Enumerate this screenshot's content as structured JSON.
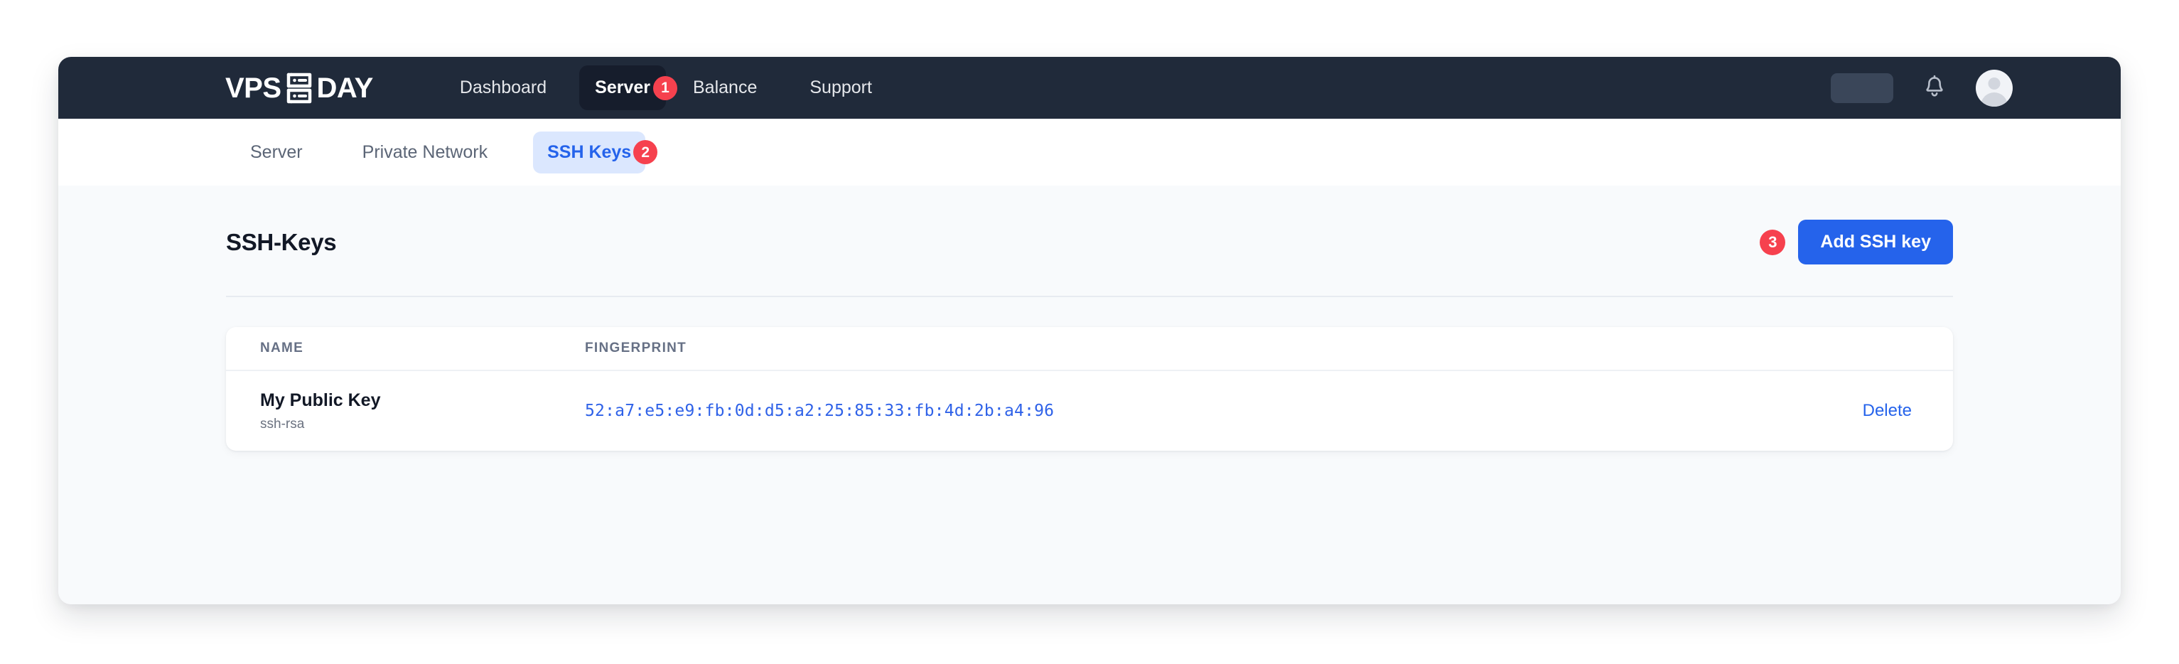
{
  "brand": {
    "text_left": "VPS",
    "text_right": "DAY",
    "icon": "server-rack-icon"
  },
  "navbar": {
    "links": [
      {
        "label": "Dashboard",
        "active": false,
        "badge": null
      },
      {
        "label": "Server",
        "active": true,
        "badge": "1"
      },
      {
        "label": "Balance",
        "active": false,
        "badge": null
      },
      {
        "label": "Support",
        "active": false,
        "badge": null
      }
    ],
    "right": {
      "placeholder_block": "",
      "bell": "bell-icon",
      "avatar": "user-avatar-icon"
    },
    "bg_color": "#202a3a",
    "active_bg_color": "#161d2c"
  },
  "tabs": [
    {
      "label": "Server",
      "active": false,
      "badge": null
    },
    {
      "label": "Private Network",
      "active": false,
      "badge": null
    },
    {
      "label": "SSH Keys",
      "active": true,
      "badge": "2"
    }
  ],
  "page": {
    "title": "SSH-Keys",
    "action_badge": "3",
    "add_button_label": "Add SSH key",
    "accent_color": "#2563eb",
    "badge_color": "#f6414e"
  },
  "table": {
    "columns": [
      "NAME",
      "FINGERPRINT",
      ""
    ],
    "rows": [
      {
        "name": "My Public Key",
        "type": "ssh-rsa",
        "fingerprint": "52:a7:e5:e9:fb:0d:d5:a2:25:85:33:fb:4d:2b:a4:96",
        "action": "Delete"
      }
    ]
  }
}
